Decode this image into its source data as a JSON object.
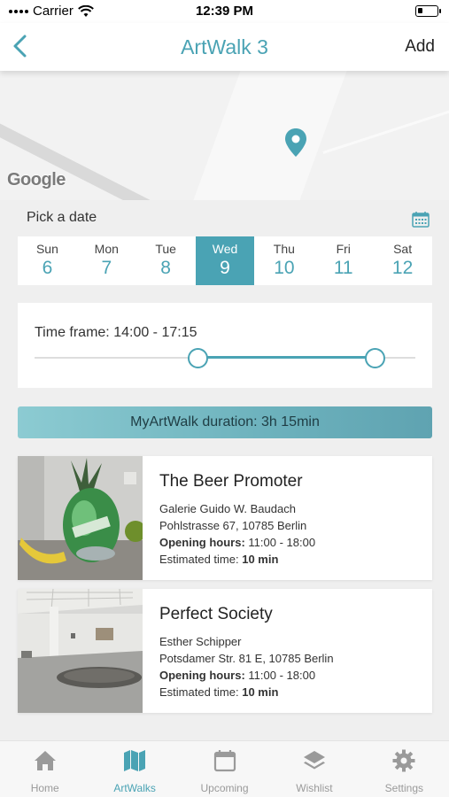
{
  "status_bar": {
    "carrier": "Carrier",
    "time": "12:39 PM"
  },
  "nav": {
    "title": "ArtWalk 3",
    "add_label": "Add",
    "back_icon": "chevron-left-icon"
  },
  "map": {
    "attribution": "Google",
    "pin_icon": "map-pin-icon"
  },
  "date_picker": {
    "label": "Pick a date",
    "calendar_icon": "calendar-icon",
    "days": [
      {
        "name": "Sun",
        "date": "6"
      },
      {
        "name": "Mon",
        "date": "7"
      },
      {
        "name": "Tue",
        "date": "8"
      },
      {
        "name": "Wed",
        "date": "9"
      },
      {
        "name": "Thu",
        "date": "10"
      },
      {
        "name": "Fri",
        "date": "11"
      },
      {
        "name": "Sat",
        "date": "12"
      }
    ],
    "selected_index": 3
  },
  "time_frame": {
    "label": "Time frame: 14:00 - 17:15",
    "start": "14:00",
    "end": "17:15"
  },
  "duration": {
    "text": "MyArtWalk duration: 3h 15min"
  },
  "artworks": [
    {
      "title": "The Beer Promoter",
      "gallery": "Galerie Guido W. Baudach",
      "address": "Pohlstrasse 67, 10785 Berlin",
      "hours_label": "Opening hours:",
      "hours": "11:00 - 18:00",
      "est_label": "Estimated time:",
      "est": "10 min"
    },
    {
      "title": "Perfect Society",
      "gallery": "Esther Schipper",
      "address": "Potsdamer Str. 81 E, 10785 Berlin",
      "hours_label": "Opening hours:",
      "hours": "11:00 - 18:00",
      "est_label": "Estimated time:",
      "est": "10 min"
    }
  ],
  "tabs": [
    {
      "label": "Home",
      "icon": "home-icon"
    },
    {
      "label": "ArtWalks",
      "icon": "map-icon",
      "active": true
    },
    {
      "label": "Upcoming",
      "icon": "calendar-icon"
    },
    {
      "label": "Wishlist",
      "icon": "layers-icon"
    },
    {
      "label": "Settings",
      "icon": "gear-icon"
    }
  ],
  "colors": {
    "accent": "#4aa3b4",
    "background": "#efefef",
    "inactive": "#9a9a9a"
  }
}
